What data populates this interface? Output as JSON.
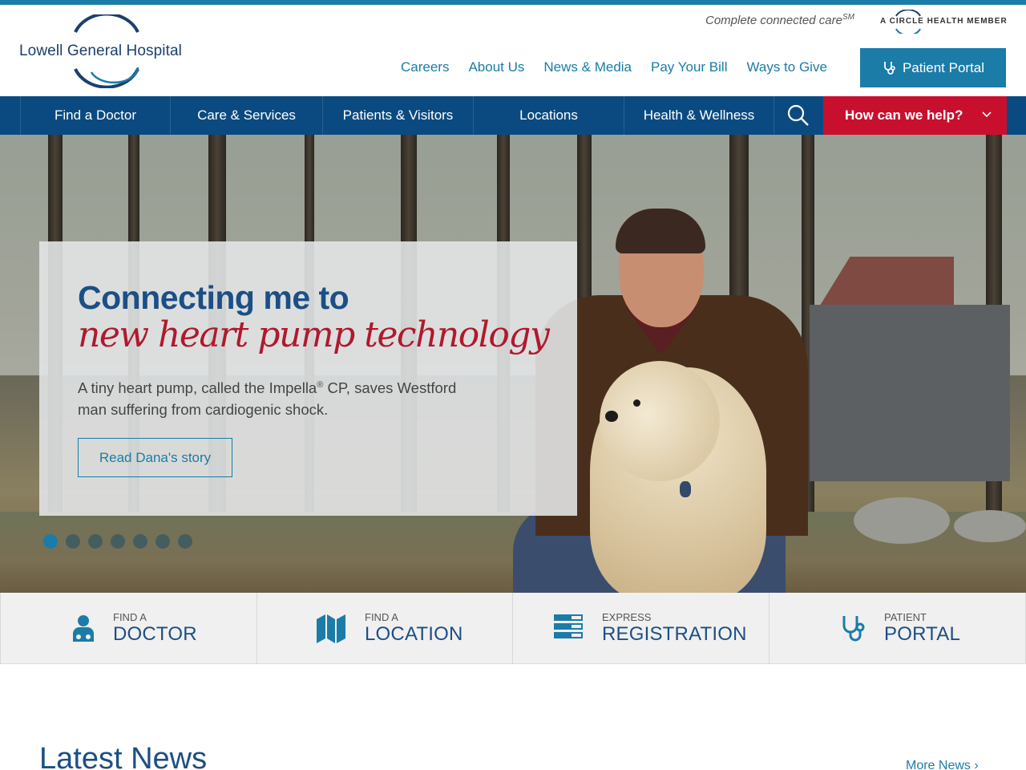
{
  "brand": {
    "logo_text": "Lowell General Hospital",
    "tagline": "Complete connected care",
    "tagline_mark": "SM",
    "badge_text": "A CIRCLE HEALTH MEMBER",
    "accent": "#1b7ca8",
    "navy": "#0b4a80",
    "red": "#c8102e"
  },
  "util_nav": [
    "Careers",
    "About Us",
    "News & Media",
    "Pay Your Bill",
    "Ways to Give"
  ],
  "patient_portal": {
    "label": "Patient Portal",
    "icon": "stethoscope-icon"
  },
  "main_nav": [
    "Find a Doctor",
    "Care & Services",
    "Patients & Visitors",
    "Locations",
    "Health & Wellness"
  ],
  "search_icon": "search-icon",
  "help": {
    "label": "How can we help?",
    "icon": "chevron-down-icon"
  },
  "hero": {
    "headline": "Connecting me to",
    "subheadline": "new heart pump technology",
    "body_part1": "A tiny heart pump, called the Impella",
    "body_reg": "®",
    "body_part2": " CP, saves Westford man suffering from cardiogenic shock.",
    "cta": "Read Dana's story",
    "slide_count": 7,
    "active_slide": 1
  },
  "quick_links": [
    {
      "small": "FIND A",
      "big": "DOCTOR",
      "icon": "doctor-icon"
    },
    {
      "small": "FIND A",
      "big": "LOCATION",
      "icon": "map-icon"
    },
    {
      "small": "EXPRESS",
      "big": "REGISTRATION",
      "icon": "registration-icon"
    },
    {
      "small": "PATIENT",
      "big": "PORTAL",
      "icon": "stethoscope-icon"
    }
  ],
  "news": {
    "title": "Latest News",
    "more": "More News ›"
  }
}
